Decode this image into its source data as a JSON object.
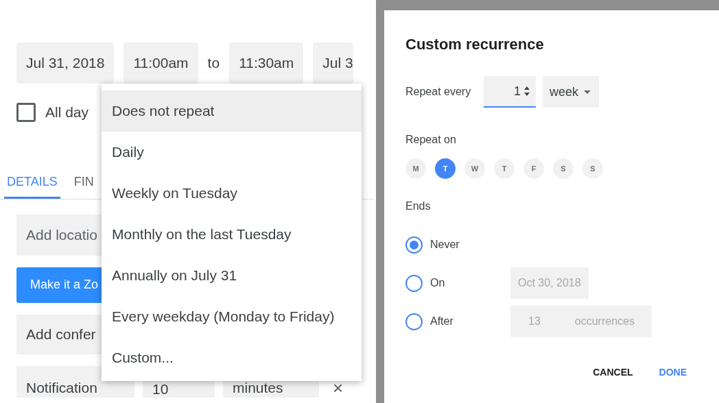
{
  "event": {
    "start_date": "Jul 31, 2018",
    "start_time": "11:00am",
    "separator": "to",
    "end_time": "11:30am",
    "end_date": "Jul 3",
    "all_day": {
      "label": "All day",
      "checked": false
    },
    "tabs": [
      {
        "label": "DETAILS",
        "selected": true
      },
      {
        "label": "FIN",
        "selected": false
      }
    ],
    "location": {
      "placeholder": "Add locatio"
    },
    "zoom_button": "Make it a Zo",
    "conference": {
      "placeholder": "Add confer"
    },
    "notification": {
      "type": "Notification",
      "value": "10",
      "unit": "minutes",
      "remove": "×"
    }
  },
  "repeat_menu": [
    {
      "label": "Does not repeat",
      "selected": true
    },
    {
      "label": "Daily",
      "selected": false
    },
    {
      "label": "Weekly on Tuesday",
      "selected": false
    },
    {
      "label": "Monthly on the last Tuesday",
      "selected": false
    },
    {
      "label": "Annually on July 31",
      "selected": false
    },
    {
      "label": "Every weekday (Monday to Friday)",
      "selected": false
    },
    {
      "label": "Custom...",
      "selected": false
    }
  ],
  "dialog": {
    "title": "Custom recurrence",
    "repeat_every_label": "Repeat every",
    "interval": "1",
    "unit": "week",
    "repeat_on_label": "Repeat on",
    "days": [
      {
        "label": "M",
        "selected": false
      },
      {
        "label": "T",
        "selected": true
      },
      {
        "label": "W",
        "selected": false
      },
      {
        "label": "T",
        "selected": false
      },
      {
        "label": "F",
        "selected": false
      },
      {
        "label": "S",
        "selected": false
      },
      {
        "label": "S",
        "selected": false
      }
    ],
    "ends_label": "Ends",
    "ends": [
      {
        "label": "Never",
        "selected": true
      },
      {
        "label": "On",
        "selected": false,
        "field": {
          "value": "Oct 30, 2018",
          "disabled": true
        }
      },
      {
        "label": "After",
        "selected": false,
        "field": {
          "value": "13",
          "suffix": "occurrences",
          "disabled": true
        }
      }
    ],
    "buttons": [
      {
        "label": "CANCEL",
        "kind": "secondary"
      },
      {
        "label": "DONE",
        "kind": "primary"
      }
    ]
  }
}
